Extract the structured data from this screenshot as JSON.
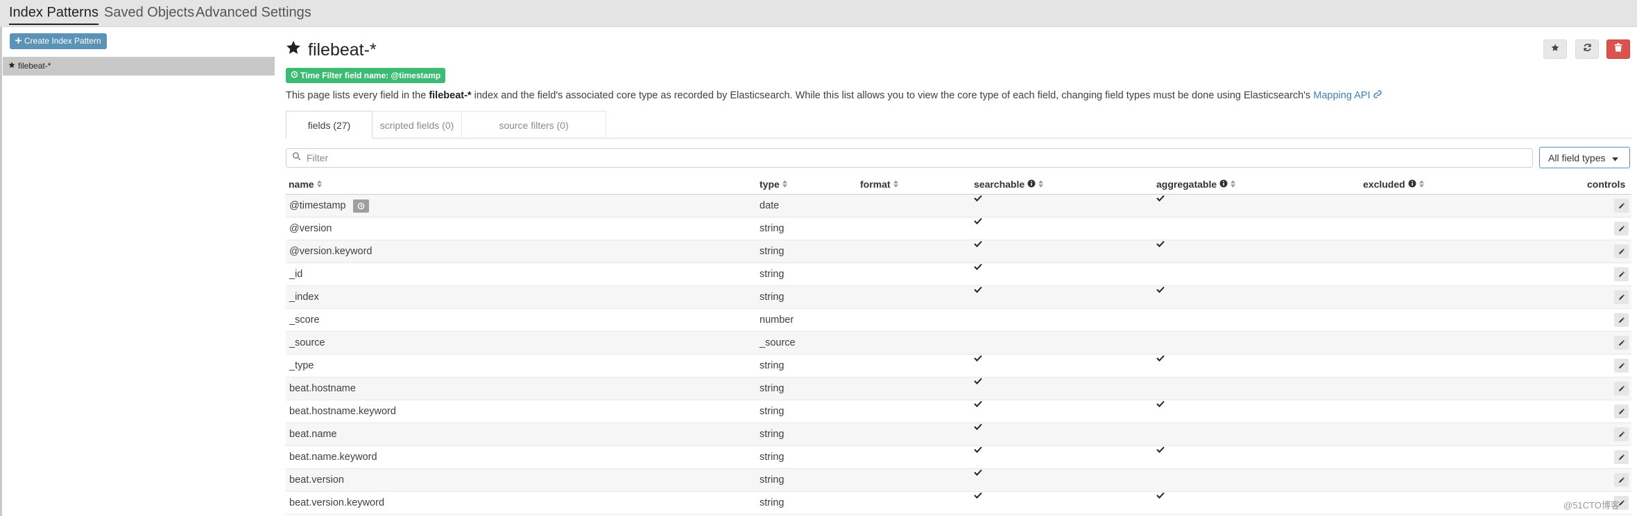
{
  "nav": {
    "tabs": [
      "Index Patterns",
      "Saved Objects",
      "Advanced Settings"
    ]
  },
  "sidebar": {
    "create_label": "Create Index Pattern",
    "patterns": [
      "filebeat-*"
    ]
  },
  "header": {
    "title": "filebeat-*",
    "time_filter_badge": "Time Filter field name: @timestamp",
    "desc_pre": "This page lists every field in the ",
    "desc_bold": "filebeat-*",
    "desc_post": " index and the field's associated core type as recorded by Elasticsearch. While this list allows you to view the core type of each field, changing field types must be done using Elasticsearch's ",
    "desc_link": "Mapping API"
  },
  "tabs": [
    {
      "label": "fields (27)"
    },
    {
      "label": "scripted fields (0)"
    },
    {
      "label": "source filters (0)"
    }
  ],
  "filter": {
    "placeholder": "Filter"
  },
  "type_select": {
    "value": "All field types"
  },
  "columns": {
    "name": "name",
    "type": "type",
    "format": "format",
    "searchable": "searchable",
    "aggregatable": "aggregatable",
    "excluded": "excluded",
    "controls": "controls"
  },
  "rows": [
    {
      "name": "@timestamp",
      "type": "date",
      "searchable": true,
      "aggregatable": true,
      "time_field": true
    },
    {
      "name": "@version",
      "type": "string",
      "searchable": true,
      "aggregatable": false
    },
    {
      "name": "@version.keyword",
      "type": "string",
      "searchable": true,
      "aggregatable": true
    },
    {
      "name": "_id",
      "type": "string",
      "searchable": true,
      "aggregatable": false
    },
    {
      "name": "_index",
      "type": "string",
      "searchable": true,
      "aggregatable": true
    },
    {
      "name": "_score",
      "type": "number",
      "searchable": false,
      "aggregatable": false
    },
    {
      "name": "_source",
      "type": "_source",
      "searchable": false,
      "aggregatable": false
    },
    {
      "name": "_type",
      "type": "string",
      "searchable": true,
      "aggregatable": true
    },
    {
      "name": "beat.hostname",
      "type": "string",
      "searchable": true,
      "aggregatable": false
    },
    {
      "name": "beat.hostname.keyword",
      "type": "string",
      "searchable": true,
      "aggregatable": true
    },
    {
      "name": "beat.name",
      "type": "string",
      "searchable": true,
      "aggregatable": false
    },
    {
      "name": "beat.name.keyword",
      "type": "string",
      "searchable": true,
      "aggregatable": true
    },
    {
      "name": "beat.version",
      "type": "string",
      "searchable": true,
      "aggregatable": false
    },
    {
      "name": "beat.version.keyword",
      "type": "string",
      "searchable": true,
      "aggregatable": true
    }
  ],
  "watermark": "@51CTO博客",
  "colors": {
    "accent": "#5b93b7",
    "success": "#3cbb72",
    "danger": "#d9534f",
    "link": "#3f7fb3"
  }
}
